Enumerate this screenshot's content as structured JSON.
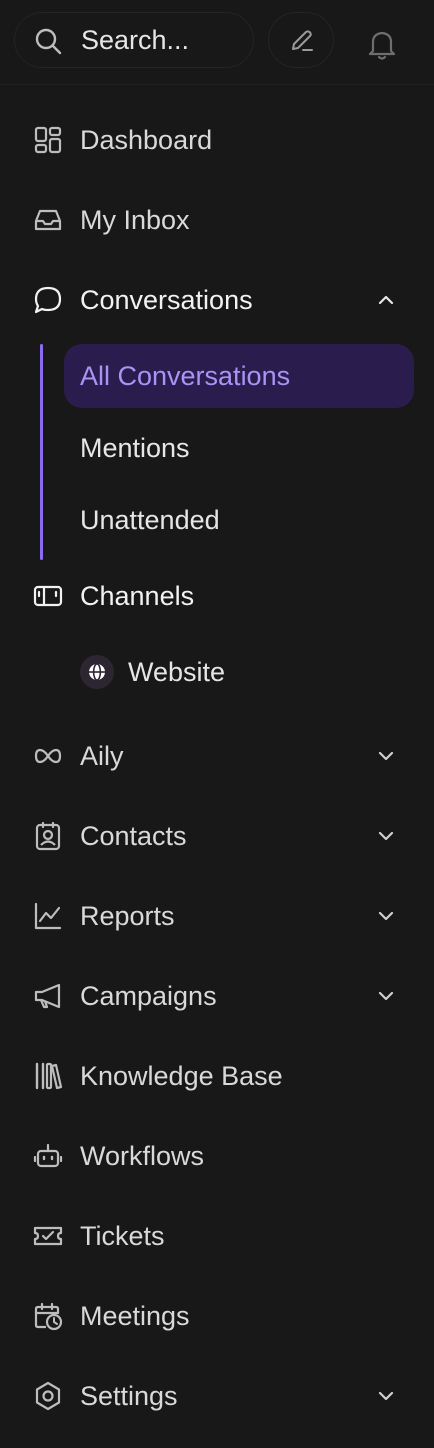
{
  "search": {
    "placeholder": "Search..."
  },
  "nav": {
    "dashboard": "Dashboard",
    "inbox": "My Inbox",
    "conversations": "Conversations",
    "sub": {
      "all": "All Conversations",
      "mentions": "Mentions",
      "unattended": "Unattended"
    },
    "channels": "Channels",
    "website": "Website",
    "aily": "Aily",
    "contacts": "Contacts",
    "reports": "Reports",
    "campaigns": "Campaigns",
    "knowledge": "Knowledge Base",
    "workflows": "Workflows",
    "tickets": "Tickets",
    "meetings": "Meetings",
    "settings": "Settings"
  },
  "colors": {
    "background": "#181818",
    "accent": "#8b6cf0",
    "active_bg": "#2a1d4d",
    "active_text": "#a993f5"
  }
}
